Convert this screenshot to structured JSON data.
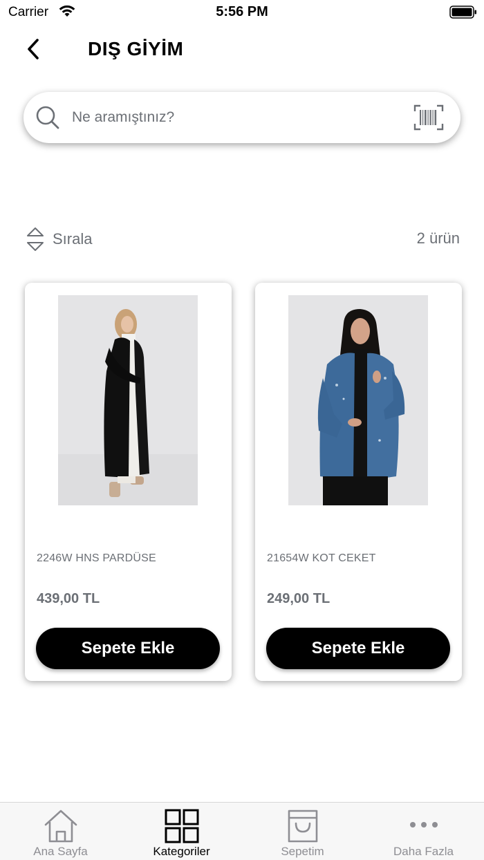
{
  "status_bar": {
    "carrier": "Carrier",
    "time": "5:56 PM"
  },
  "header": {
    "title": "DIŞ GİYİM",
    "back_icon": "chevron-left-icon"
  },
  "search": {
    "placeholder": "Ne aramıştınız?",
    "value": "",
    "icon": "search-icon",
    "scan_icon": "barcode-scan-icon"
  },
  "sort": {
    "label": "Sırala",
    "icon": "sort-icon"
  },
  "product_count": "2 ürün",
  "products": [
    {
      "name": "2246W HNS PARDÜSE",
      "price": "439,00 TL",
      "button_label": "Sepete Ekle"
    },
    {
      "name": "21654W KOT CEKET",
      "price": "249,00 TL",
      "button_label": "Sepete Ekle"
    }
  ],
  "tab_bar": {
    "tabs": [
      {
        "label": "Ana Sayfa",
        "icon": "home-icon",
        "active": false
      },
      {
        "label": "Kategoriler",
        "icon": "grid-icon",
        "active": true
      },
      {
        "label": "Sepetim",
        "icon": "shopping-bag-icon",
        "active": false
      },
      {
        "label": "Daha Fazla",
        "icon": "more-icon",
        "active": false
      }
    ]
  },
  "colors": {
    "primary_button": "#000000",
    "muted_text": "#6b6f75",
    "tab_inactive": "#8e8e93",
    "image_background": "#e3e3e5"
  }
}
